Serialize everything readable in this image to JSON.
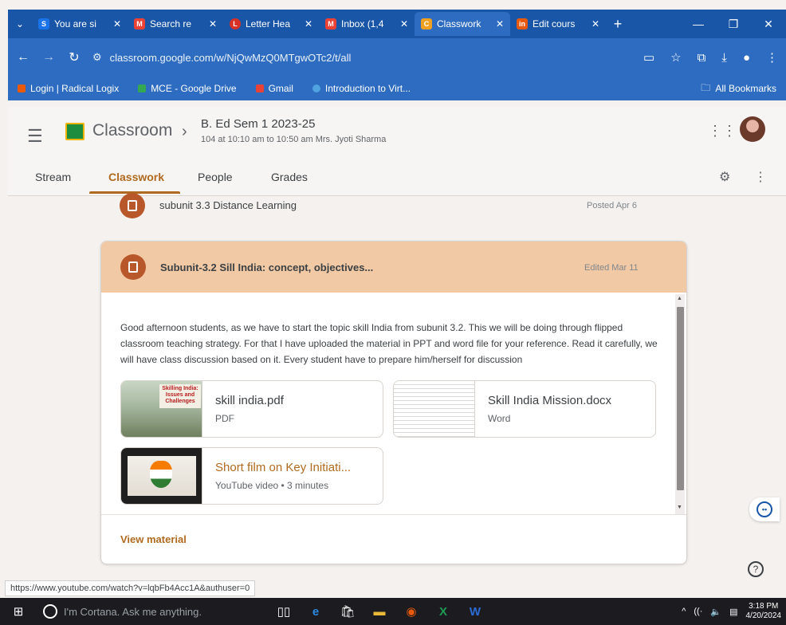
{
  "browser": {
    "tabs": [
      {
        "label": "You are si",
        "favicon": "S",
        "favicon_color": "#1a73e8"
      },
      {
        "label": "Search re",
        "favicon": "M",
        "favicon_color": "#ea4335"
      },
      {
        "label": "Letter Hea",
        "favicon": "L",
        "favicon_color": "#d93025"
      },
      {
        "label": "Inbox (1,4",
        "favicon": "M",
        "favicon_color": "#ea4335"
      },
      {
        "label": "Classwork",
        "favicon": "C",
        "favicon_color": "#f0a020",
        "active": true
      },
      {
        "label": "Edit cours",
        "favicon": "in",
        "favicon_color": "#e8590c"
      }
    ],
    "url": "classroom.google.com/w/NjQwMzQ0MTgwOTc2/t/all",
    "bookmarks": [
      "Login | Radical Logix",
      "MCE - Google Drive",
      "Gmail",
      "Introduction to Virt..."
    ],
    "all_bookmarks": "All Bookmarks"
  },
  "classroom": {
    "app_title": "Classroom",
    "course_name": "B. Ed Sem 1 2023-25",
    "course_subtitle": "104 at 10:10 am to 10:50 am Mrs. Jyoti Sharma",
    "nav_tabs": [
      "Stream",
      "Classwork",
      "People",
      "Grades"
    ],
    "active_tab": "Classwork"
  },
  "items": {
    "prev": {
      "title": "subunit 3.3 Distance Learning",
      "date": "Posted Apr 6"
    },
    "card": {
      "title": "Subunit-3.2 Sill India: concept, objectives...",
      "date": "Edited Mar 11",
      "description": "Good afternoon students, as we have to start the topic skill India from subunit 3.2. This we will be doing through flipped classroom teaching strategy. For that I have uploaded the material in PPT and word file for your reference. Read it carefully, we will have class discussion based on it. Every student have to prepare him/herself for discussion",
      "attachments": [
        {
          "title": "skill india.pdf",
          "type": "PDF",
          "thumb_text": "Skilling India: Issues and Challenges"
        },
        {
          "title": "Skill India Mission.docx",
          "type": "Word"
        },
        {
          "title": "Short film on Key Initiati...",
          "type": "YouTube video • 3 minutes"
        }
      ],
      "view_material": "View material"
    }
  },
  "status_url": "https://www.youtube.com/watch?v=lqbFb4Acc1A&authuser=0",
  "taskbar": {
    "cortana_text": "I'm Cortana. Ask me anything.",
    "time": "3:18 PM",
    "date": "4/20/2024"
  },
  "colors": {
    "accent": "#b06a20",
    "card_header": "#f1c9a5",
    "chrome": "#2d6cc0",
    "icon_circle": "#b8572a"
  }
}
